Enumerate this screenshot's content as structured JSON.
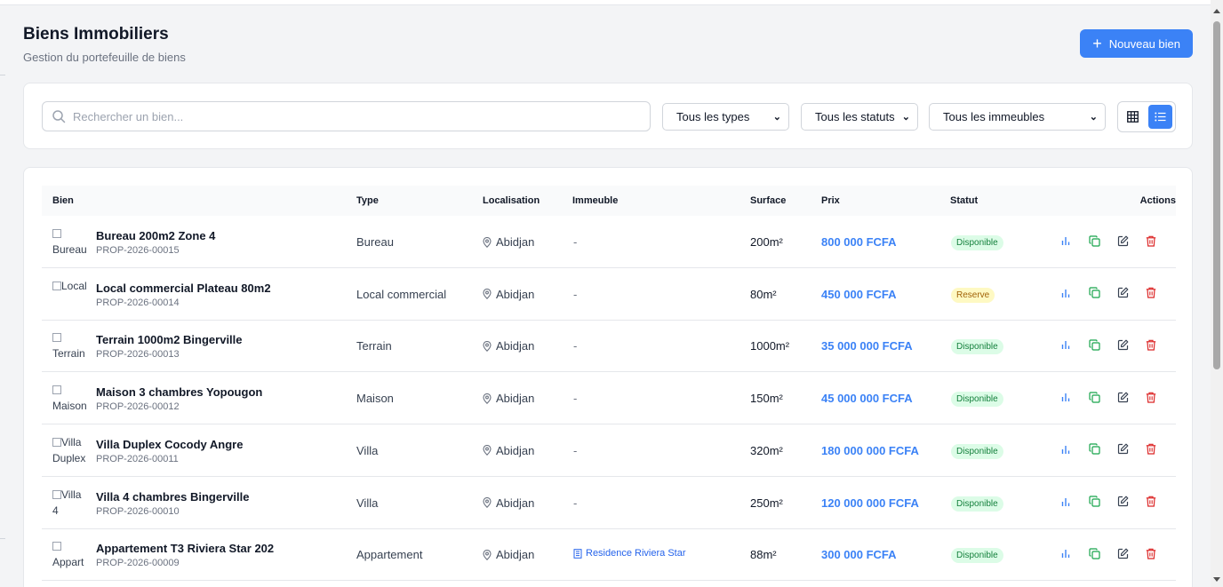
{
  "header": {
    "title": "Biens Immobiliers",
    "subtitle": "Gestion du portefeuille de biens",
    "new_button_label": "Nouveau bien"
  },
  "filters": {
    "search_placeholder": "Rechercher un bien...",
    "type_select": "Tous les types",
    "status_select": "Tous les statuts",
    "building_select": "Tous les immeubles",
    "view_mode": "list"
  },
  "table": {
    "headers": {
      "bien": "Bien",
      "type": "Type",
      "localisation": "Localisation",
      "immeuble": "Immeuble",
      "surface": "Surface",
      "prix": "Prix",
      "statut": "Statut",
      "actions": "Actions"
    },
    "rows": [
      {
        "thumb_alt": "Bureau",
        "name": "Bureau 200m2 Zone 4",
        "ref": "PROP-2026-00015",
        "type": "Bureau",
        "location": "Abidjan",
        "building": "-",
        "surface": "200m²",
        "price": "800 000 FCFA",
        "status": "Disponible"
      },
      {
        "thumb_alt": "Local",
        "name": "Local commercial Plateau 80m2",
        "ref": "PROP-2026-00014",
        "type": "Local commercial",
        "location": "Abidjan",
        "building": "-",
        "surface": "80m²",
        "price": "450 000 FCFA",
        "status": "Reserve"
      },
      {
        "thumb_alt": "Terrain",
        "name": "Terrain 1000m2 Bingerville",
        "ref": "PROP-2026-00013",
        "type": "Terrain",
        "location": "Abidjan",
        "building": "-",
        "surface": "1000m²",
        "price": "35 000 000 FCFA",
        "status": "Disponible"
      },
      {
        "thumb_alt": "Maison",
        "name": "Maison 3 chambres Yopougon",
        "ref": "PROP-2026-00012",
        "type": "Maison",
        "location": "Abidjan",
        "building": "-",
        "surface": "150m²",
        "price": "45 000 000 FCFA",
        "status": "Disponible"
      },
      {
        "thumb_alt": "Villa Duplex",
        "name": "Villa Duplex Cocody Angre",
        "ref": "PROP-2026-00011",
        "type": "Villa",
        "location": "Abidjan",
        "building": "-",
        "surface": "320m²",
        "price": "180 000 000 FCFA",
        "status": "Disponible"
      },
      {
        "thumb_alt": "Villa 4",
        "name": "Villa 4 chambres Bingerville",
        "ref": "PROP-2026-00010",
        "type": "Villa",
        "location": "Abidjan",
        "building": "-",
        "surface": "250m²",
        "price": "120 000 000 FCFA",
        "status": "Disponible"
      },
      {
        "thumb_alt": "Appart",
        "name": "Appartement T3 Riviera Star 202",
        "ref": "PROP-2026-00009",
        "type": "Appartement",
        "location": "Abidjan",
        "building": "Residence Riviera Star",
        "surface": "88m²",
        "price": "300 000 FCFA",
        "status": "Disponible"
      }
    ]
  },
  "colors": {
    "primary": "#3b82f6",
    "available_bg": "#dcfce7",
    "available_text": "#15803d",
    "reserved_bg": "#fef9c3",
    "reserved_text": "#a16207",
    "delete": "#dc2626",
    "duplicate": "#16a34a"
  }
}
